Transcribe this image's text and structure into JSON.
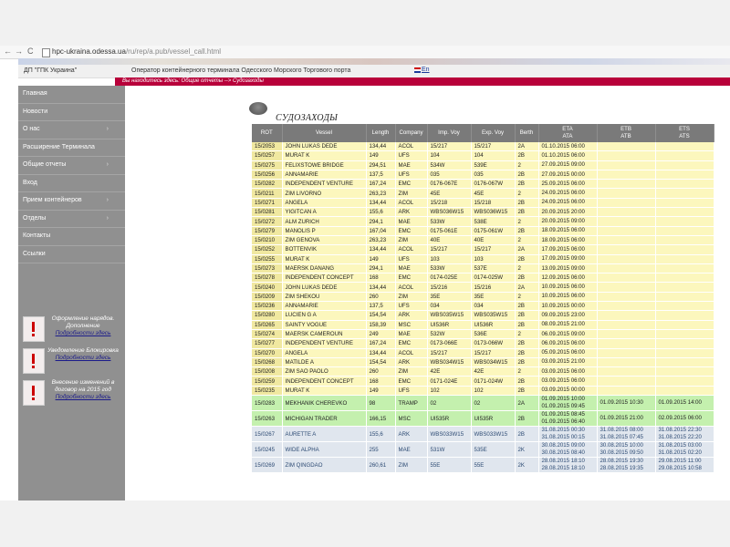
{
  "browser": {
    "nav": {
      "back": "←",
      "forward": "→",
      "reload": "C"
    },
    "url": "hpc-ukraina.odessa.ua",
    "url_path": "/ru/rep/a.pub/vessel_call.html"
  },
  "header": {
    "company": "ДП \"ГПК Украина\"",
    "operator": "Оператор контейнерного терминала Одесского Морского Торгового порта",
    "lang_link": "En"
  },
  "breadcrumb": "Вы находитесь здесь: Общие отчеты --> Судозаходы",
  "sidebar": {
    "items": [
      {
        "label": "Главная",
        "arrow": ""
      },
      {
        "label": "Новости",
        "arrow": ""
      },
      {
        "label": "О нас",
        "arrow": "›"
      },
      {
        "label": "Расширение Терминала",
        "arrow": ""
      },
      {
        "label": "Общие отчеты",
        "arrow": "›"
      },
      {
        "label": "Вход",
        "arrow": ""
      },
      {
        "label": "Прием контейнеров",
        "arrow": "›"
      },
      {
        "label": "Отделы",
        "arrow": "›"
      },
      {
        "label": "Контакты",
        "arrow": ""
      },
      {
        "label": "Ссылки",
        "arrow": ""
      }
    ],
    "notices": [
      {
        "text": "Оформление нарядов. Дополнение",
        "link": "Подробности здесь"
      },
      {
        "text": "Уведомление Блокировка",
        "link": "Подробности здесь"
      },
      {
        "text": "Внесение изменений в договор на 2015 год",
        "link": "Подробности здесь"
      }
    ]
  },
  "page_title": "СУДОЗАХОДЫ",
  "table": {
    "headers": {
      "rot": "ROT",
      "vessel": "Vessel",
      "length": "Length",
      "company": "Company",
      "imp": "Imp. Voy",
      "exp": "Exp. Voy",
      "berth": "Berth",
      "eta": "ETA",
      "ata": "ATA",
      "etb": "ETB",
      "atb": "ATB",
      "ets": "ETS",
      "ats": "ATS"
    },
    "rows": [
      {
        "rot": "15/2053",
        "vessel": "JOHN LUKAS DEDE",
        "length": "134,44",
        "company": "ACOL",
        "imp": "15/217",
        "exp": "15/217",
        "berth": "2A",
        "eta": "01.10.2015 06:00",
        "etb": "",
        "ets": "",
        "style": "y"
      },
      {
        "rot": "15/0257",
        "vessel": "MURAT K",
        "length": "149",
        "company": "UFS",
        "imp": "104",
        "exp": "104",
        "berth": "2B",
        "eta": "01.10.2015 06:00",
        "etb": "",
        "ets": "",
        "style": "y"
      },
      {
        "rot": "15/0275",
        "vessel": "FELIXSTOWE BRIDGE",
        "length": "294,51",
        "company": "MAE",
        "imp": "534W",
        "exp": "539E",
        "berth": "2",
        "eta": "27.09.2015 09:00",
        "etb": "",
        "ets": "",
        "style": "y"
      },
      {
        "rot": "15/0256",
        "vessel": "ANNAMARIE",
        "length": "137,5",
        "company": "UFS",
        "imp": "035",
        "exp": "035",
        "berth": "2B",
        "eta": "27.09.2015 00:00",
        "etb": "",
        "ets": "",
        "style": "y"
      },
      {
        "rot": "15/0282",
        "vessel": "INDEPENDENT VENTURE",
        "length": "167,24",
        "company": "EMC",
        "imp": "0176-067E",
        "exp": "0176-067W",
        "berth": "2B",
        "eta": "25.09.2015 06:00",
        "etb": "",
        "ets": "",
        "style": "y"
      },
      {
        "rot": "15/0211",
        "vessel": "ZIM LIVORNO",
        "length": "263,23",
        "company": "ZIM",
        "imp": "45E",
        "exp": "45E",
        "berth": "2",
        "eta": "24.09.2015 06:00",
        "etb": "",
        "ets": "",
        "style": "y"
      },
      {
        "rot": "15/0271",
        "vessel": "ANGELA",
        "length": "134,44",
        "company": "ACOL",
        "imp": "15/218",
        "exp": "15/218",
        "berth": "2B",
        "eta": "24.09.2015 06:00",
        "etb": "",
        "ets": "",
        "style": "y"
      },
      {
        "rot": "15/0281",
        "vessel": "YIGITCAN A",
        "length": "155,6",
        "company": "ARK",
        "imp": "WBS036W15",
        "exp": "WBS036W15",
        "berth": "2B",
        "eta": "20.09.2015 20:00",
        "etb": "",
        "ets": "",
        "style": "y"
      },
      {
        "rot": "15/0272",
        "vessel": "ALM ZURICH",
        "length": "294,1",
        "company": "MAE",
        "imp": "533W",
        "exp": "538E",
        "berth": "2",
        "eta": "20.09.2015 09:00",
        "etb": "",
        "ets": "",
        "style": "y"
      },
      {
        "rot": "15/0279",
        "vessel": "MANOLIS P",
        "length": "167,04",
        "company": "EMC",
        "imp": "0175-061E",
        "exp": "0175-061W",
        "berth": "2B",
        "eta": "18.09.2015 06:00",
        "etb": "",
        "ets": "",
        "style": "y"
      },
      {
        "rot": "15/0210",
        "vessel": "ZIM GENOVA",
        "length": "263,23",
        "company": "ZIM",
        "imp": "40E",
        "exp": "40E",
        "berth": "2",
        "eta": "18.09.2015 06:00",
        "etb": "",
        "ets": "",
        "style": "y"
      },
      {
        "rot": "15/0252",
        "vessel": "BOTTENVIK",
        "length": "134,44",
        "company": "ACOL",
        "imp": "15/217",
        "exp": "15/217",
        "berth": "2A",
        "eta": "17.09.2015 06:00",
        "etb": "",
        "ets": "",
        "style": "y"
      },
      {
        "rot": "15/0255",
        "vessel": "MURAT K",
        "length": "149",
        "company": "UFS",
        "imp": "103",
        "exp": "103",
        "berth": "2B",
        "eta": "17.09.2015 09:00",
        "etb": "",
        "ets": "",
        "style": "y"
      },
      {
        "rot": "15/0273",
        "vessel": "MAERSK DANANG",
        "length": "294,1",
        "company": "MAE",
        "imp": "533W",
        "exp": "537E",
        "berth": "2",
        "eta": "13.09.2015 09:00",
        "etb": "",
        "ets": "",
        "style": "y"
      },
      {
        "rot": "15/0278",
        "vessel": "INDEPENDENT CONCEPT",
        "length": "168",
        "company": "EMC",
        "imp": "0174-025E",
        "exp": "0174-025W",
        "berth": "2B",
        "eta": "12.09.2015 06:00",
        "etb": "",
        "ets": "",
        "style": "y"
      },
      {
        "rot": "15/0240",
        "vessel": "JOHN LUKAS DEDE",
        "length": "134,44",
        "company": "ACOL",
        "imp": "15/216",
        "exp": "15/216",
        "berth": "2A",
        "eta": "10.09.2015 06:00",
        "etb": "",
        "ets": "",
        "style": "y"
      },
      {
        "rot": "15/0209",
        "vessel": "ZIM SHEKOU",
        "length": "260",
        "company": "ZIM",
        "imp": "35E",
        "exp": "35E",
        "berth": "2",
        "eta": "10.09.2015 06:00",
        "etb": "",
        "ets": "",
        "style": "y"
      },
      {
        "rot": "15/0236",
        "vessel": "ANNAMARIE",
        "length": "137,5",
        "company": "UFS",
        "imp": "034",
        "exp": "034",
        "berth": "2B",
        "eta": "10.09.2015 00:00",
        "etb": "",
        "ets": "",
        "style": "y"
      },
      {
        "rot": "15/0280",
        "vessel": "LUCIEN G A",
        "length": "154,54",
        "company": "ARK",
        "imp": "WBS035W15",
        "exp": "WBS035W15",
        "berth": "2B",
        "eta": "09.09.2015 23:00",
        "etb": "",
        "ets": "",
        "style": "y"
      },
      {
        "rot": "15/0265",
        "vessel": "SAINTY VOGUE",
        "length": "158,39",
        "company": "MSC",
        "imp": "UI536R",
        "exp": "UI536R",
        "berth": "2B",
        "eta": "08.09.2015 21:00",
        "etb": "",
        "ets": "",
        "style": "y"
      },
      {
        "rot": "15/0274",
        "vessel": "MAERSK CAMEROUN",
        "length": "249",
        "company": "MAE",
        "imp": "532W",
        "exp": "536E",
        "berth": "2",
        "eta": "06.09.2015 09:00",
        "etb": "",
        "ets": "",
        "style": "y"
      },
      {
        "rot": "15/0277",
        "vessel": "INDEPENDENT VENTURE",
        "length": "167,24",
        "company": "EMC",
        "imp": "0173-066E",
        "exp": "0173-066W",
        "berth": "2B",
        "eta": "06.09.2015 06:00",
        "etb": "",
        "ets": "",
        "style": "y"
      },
      {
        "rot": "15/0270",
        "vessel": "ANGELA",
        "length": "134,44",
        "company": "ACOL",
        "imp": "15/217",
        "exp": "15/217",
        "berth": "2B",
        "eta": "05.09.2015 06:00",
        "etb": "",
        "ets": "",
        "style": "y"
      },
      {
        "rot": "15/0268",
        "vessel": "MATILDE A",
        "length": "154,54",
        "company": "ARK",
        "imp": "WBS034W15",
        "exp": "WBS034W15",
        "berth": "2B",
        "eta": "03.09.2015 21:00",
        "etb": "",
        "ets": "",
        "style": "y"
      },
      {
        "rot": "15/0208",
        "vessel": "ZIM SAO PAOLO",
        "length": "260",
        "company": "ZIM",
        "imp": "42E",
        "exp": "42E",
        "berth": "2",
        "eta": "03.09.2015 06:00",
        "etb": "",
        "ets": "",
        "style": "y"
      },
      {
        "rot": "15/0259",
        "vessel": "INDEPENDENT CONCEPT",
        "length": "168",
        "company": "EMC",
        "imp": "0171-024E",
        "exp": "0171-024W",
        "berth": "2B",
        "eta": "03.09.2015 06:00",
        "etb": "",
        "ets": "",
        "style": "y"
      },
      {
        "rot": "15/0235",
        "vessel": "MURAT K",
        "length": "149",
        "company": "UFS",
        "imp": "102",
        "exp": "102",
        "berth": "2B",
        "eta": "03.09.2015 00:00",
        "etb": "",
        "ets": "",
        "style": "y"
      },
      {
        "rot": "15/0283",
        "vessel": "MEKHANIK CHEREVKO",
        "length": "98",
        "company": "TRAMP",
        "imp": "02",
        "exp": "02",
        "berth": "2A",
        "eta": "01.09.2015 10:00",
        "ata": "01.09.2015 09:45",
        "etb": "01.09.2015 10:30",
        "ets": "01.09.2015 14:00",
        "style": "g"
      },
      {
        "rot": "15/0263",
        "vessel": "MICHIGAN TRADER",
        "length": "166,15",
        "company": "MSC",
        "imp": "UI535R",
        "exp": "UI535R",
        "berth": "2B",
        "eta": "01.09.2015 08:45",
        "ata": "01.09.2015 06:40",
        "etb": "01.09.2015 21:00",
        "ets": "02.09.2015 06:00",
        "style": "g"
      },
      {
        "rot": "15/0267",
        "vessel": "AURETTE A",
        "length": "155,6",
        "company": "ARK",
        "imp": "WBS033W15",
        "exp": "WBS033W15",
        "berth": "2B",
        "eta": "31.08.2015 00:30",
        "ata": "31.08.2015 00:15",
        "etb": "31.08.2015 08:00",
        "atb": "31.08.2015 07:45",
        "ets": "31.08.2015 22:30",
        "ats": "31.08.2015 22:20",
        "style": "b"
      },
      {
        "rot": "15/0245",
        "vessel": "WIDE ALPHA",
        "length": "255",
        "company": "MAE",
        "imp": "531W",
        "exp": "535E",
        "berth": "2K",
        "eta": "30.08.2015 09:00",
        "ata": "30.08.2015 08:40",
        "etb": "30.08.2015 10:00",
        "atb": "30.08.2015 09:50",
        "ets": "31.08.2015 03:00",
        "ats": "31.08.2015 02:20",
        "style": "b"
      },
      {
        "rot": "15/0269",
        "vessel": "ZIM QINGDAO",
        "length": "260,61",
        "company": "ZIM",
        "imp": "55E",
        "exp": "55E",
        "berth": "2K",
        "eta": "28.08.2015 18:10",
        "ata": "28.08.2015 18:10",
        "etb": "28.08.2015 19:30",
        "atb": "28.08.2015 19:35",
        "ets": "29.08.2015 11:00",
        "ats": "29.08.2015 10:58",
        "style": "b"
      }
    ]
  }
}
